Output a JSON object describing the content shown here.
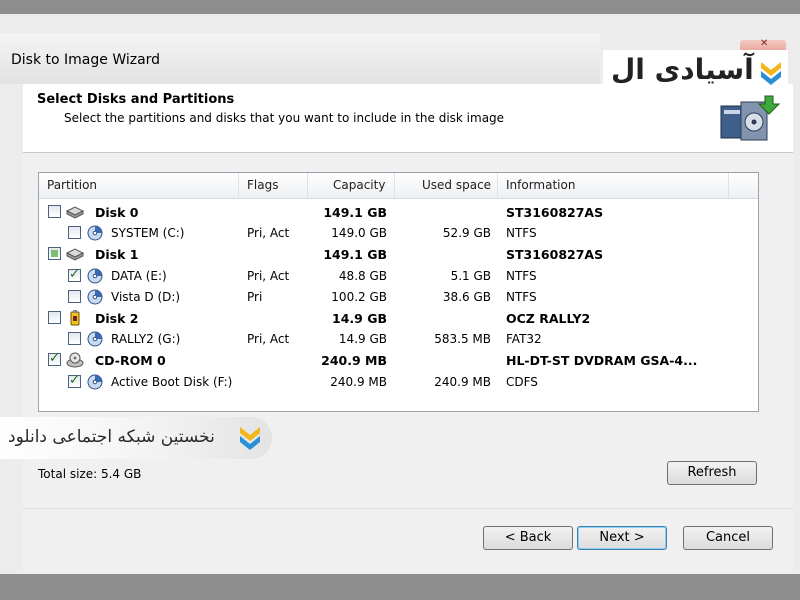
{
  "window": {
    "title": "Disk to Image Wizard"
  },
  "header": {
    "title": "Select Disks and Partitions",
    "subtitle": "Select the partitions and disks that you want to include in the disk image"
  },
  "logo": {
    "text": "آسیادی ال"
  },
  "watermark": {
    "text": "نخستین شبکه اجتماعی دانلود"
  },
  "columns": {
    "partition": "Partition",
    "flags": "Flags",
    "capacity": "Capacity",
    "used": "Used space",
    "info": "Information"
  },
  "rows": [
    {
      "level": 0,
      "state": "unchecked",
      "icon": "hard-disk-icon",
      "name": "Disk 0",
      "flags": "",
      "capacity": "149.1 GB",
      "used": "",
      "info": "ST3160827AS",
      "bold": true
    },
    {
      "level": 1,
      "state": "unchecked",
      "icon": "partition-icon",
      "name": "SYSTEM (C:)",
      "flags": "Pri, Act",
      "capacity": "149.0 GB",
      "used": "52.9 GB",
      "info": "NTFS",
      "bold": false
    },
    {
      "level": 0,
      "state": "partial",
      "icon": "hard-disk-icon",
      "name": "Disk 1",
      "flags": "",
      "capacity": "149.1 GB",
      "used": "",
      "info": "ST3160827AS",
      "bold": true
    },
    {
      "level": 1,
      "state": "checked",
      "icon": "partition-icon",
      "name": "DATA (E:)",
      "flags": "Pri, Act",
      "capacity": "48.8 GB",
      "used": "5.1 GB",
      "info": "NTFS",
      "bold": false
    },
    {
      "level": 1,
      "state": "unchecked",
      "icon": "partition-icon",
      "name": "Vista D (D:)",
      "flags": "Pri",
      "capacity": "100.2 GB",
      "used": "38.6 GB",
      "info": "NTFS",
      "bold": false
    },
    {
      "level": 0,
      "state": "unchecked",
      "icon": "usb-drive-icon",
      "name": "Disk 2",
      "flags": "",
      "capacity": "14.9 GB",
      "used": "",
      "info": "OCZ RALLY2",
      "bold": true
    },
    {
      "level": 1,
      "state": "unchecked",
      "icon": "partition-icon",
      "name": "RALLY2 (G:)",
      "flags": "Pri, Act",
      "capacity": "14.9 GB",
      "used": "583.5 MB",
      "info": "FAT32",
      "bold": false
    },
    {
      "level": 0,
      "state": "checked",
      "icon": "cd-rom-icon",
      "name": "CD-ROM 0",
      "flags": "",
      "capacity": "240.9 MB",
      "used": "",
      "info": "HL-DT-ST DVDRAM GSA-4...",
      "bold": true
    },
    {
      "level": 1,
      "state": "checked",
      "icon": "partition-icon",
      "name": "Active Boot Disk (F:)",
      "flags": "",
      "capacity": "240.9 MB",
      "used": "240.9 MB",
      "info": "CDFS",
      "bold": false
    }
  ],
  "total": {
    "label": "Total size: 5.4 GB"
  },
  "buttons": {
    "refresh": "Refresh",
    "back": "< Back",
    "next": "Next >",
    "cancel": "Cancel"
  }
}
